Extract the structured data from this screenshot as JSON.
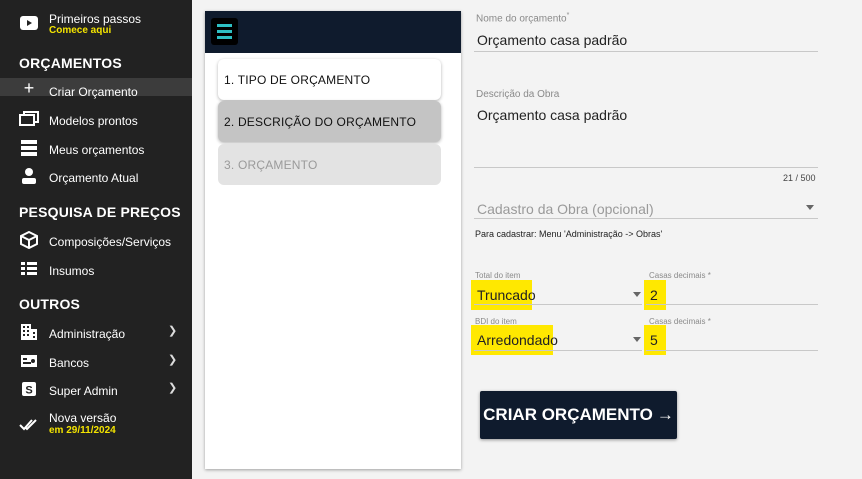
{
  "sidebar": {
    "first_steps": {
      "label": "Primeiros passos",
      "sub": "Comece aqui"
    },
    "section_budgets": "ORÇAMENTOS",
    "budgets_items": [
      {
        "label": "Criar Orçamento"
      },
      {
        "label": "Modelos prontos"
      },
      {
        "label": "Meus orçamentos"
      },
      {
        "label": "Orçamento Atual"
      }
    ],
    "section_prices": "PESQUISA DE PREÇOS",
    "prices_items": [
      {
        "label": "Composições/Serviços"
      },
      {
        "label": "Insumos"
      }
    ],
    "section_others": "OUTROS",
    "others_items": [
      {
        "label": "Administração"
      },
      {
        "label": "Bancos"
      },
      {
        "label": "Super Admin"
      }
    ],
    "new_version": {
      "label": "Nova versão",
      "sub": "em 29/11/2024"
    }
  },
  "stepper": {
    "steps": [
      {
        "label": "1. TIPO DE ORÇAMENTO"
      },
      {
        "label": "2. DESCRIÇÃO DO ORÇAMENTO"
      },
      {
        "label": "3. ORÇAMENTO"
      }
    ]
  },
  "form": {
    "name_label": "Nome do orçamento",
    "name_required": "*",
    "name_value": "Orçamento casa padrão",
    "desc_label": "Descrição da Obra",
    "desc_value": "Orçamento casa padrão",
    "desc_counter": "21 / 500",
    "work_placeholder": "Cadastro da Obra (opcional)",
    "work_hint": "Para cadastrar: Menu 'Administração -> Obras'",
    "total_label": "Total do item",
    "total_value": "Truncado",
    "total_decimals_label": "Casas decimais *",
    "total_decimals_value": "2",
    "bdi_label": "BDI do item",
    "bdi_value": "Arredondado",
    "bdi_decimals_label": "Casas decimais *",
    "bdi_decimals_value": "5",
    "create_button": "CRIAR ORÇAMENTO",
    "create_arrow": "→"
  },
  "colors": {
    "sidebar_bg": "#222222",
    "accent_yellow": "#f4e400",
    "highlight": "#ffe800",
    "navy": "#0f1b2d",
    "teal": "#2ec0c4"
  }
}
